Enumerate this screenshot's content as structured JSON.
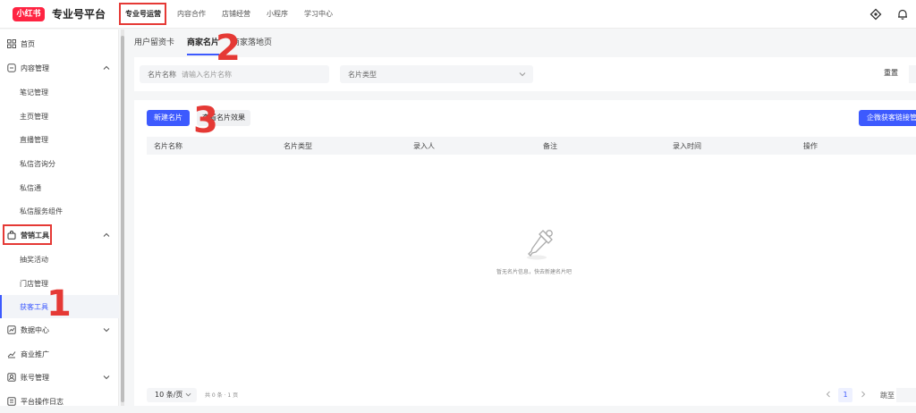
{
  "app": {
    "logo_text": "小红书",
    "brand": "专业号平台",
    "accent": "#3d5afe",
    "brand_color": "#ff2442",
    "annotation_color": "#e53935"
  },
  "topnav": [
    "专业号运营",
    "内容合作",
    "店铺经营",
    "小程序",
    "学习中心"
  ],
  "top_icons": [
    "support-icon",
    "bell-icon"
  ],
  "sidebar": {
    "home": "首页",
    "content_mgmt": "内容管理",
    "notes": "笔记管理",
    "homepage": "主页管理",
    "live": "直播管理",
    "dm_score": "私信咨询分",
    "dm_tong": "私信通",
    "dm_widget": "私信服务组件",
    "marketing": "营销工具",
    "lottery": "抽奖活动",
    "store": "门店管理",
    "acquire": "获客工具",
    "data_center": "数据中心",
    "ads": "商业推广",
    "account": "账号管理",
    "oplog": "平台操作日志"
  },
  "tabs": [
    "用户留资卡",
    "商家名片",
    "商家落地页"
  ],
  "filters": {
    "name_label": "名片名称",
    "name_placeholder": "请输入名片名称",
    "type_label": "名片类型",
    "reset": "重置"
  },
  "actions": {
    "create": "新建名片",
    "preview": "查看名片效果",
    "wecom": "企微获客链接管理"
  },
  "table": {
    "columns": [
      "名片名称",
      "名片类型",
      "录入人",
      "备注",
      "录入时间",
      "操作"
    ],
    "empty_text": "暂无名片信息，快去新建名片吧"
  },
  "pager": {
    "page_size": "10 条/页",
    "total": "共 0 条 · 1 页",
    "current_page": "1",
    "jump": "跳至"
  },
  "annotations": [
    "1",
    "2",
    "3"
  ]
}
